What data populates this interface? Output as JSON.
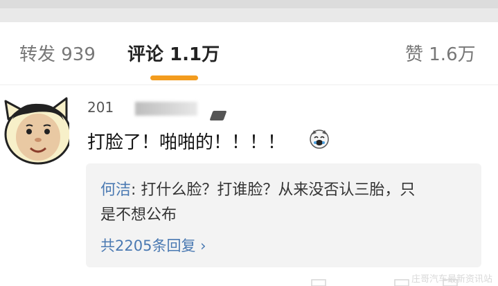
{
  "tabs": {
    "repost": "转发 939",
    "comment": "评论 1.1万",
    "likes": "赞 1.6万"
  },
  "comment": {
    "username": "201",
    "text": "打脸了！啪啪的！！！！",
    "emoji": "laughing-cat-emoji"
  },
  "reply": {
    "author": "何洁",
    "separator": ": ",
    "line1": "打什么脸？打谁脸？从来没否认三胎，只",
    "line2": "是不想公布",
    "count_label": "共2205条回复 ",
    "chevron": "›"
  },
  "watermark": "庄哥汽车最新资讯站",
  "colors": {
    "accent": "#f39c1e",
    "link": "#4a79b2",
    "reply_bg": "#f3f3f3"
  }
}
